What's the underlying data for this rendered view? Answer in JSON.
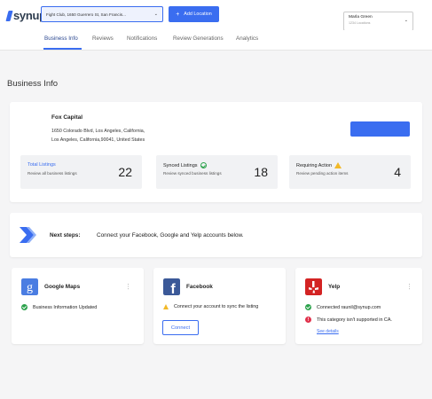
{
  "brand": {
    "logo_text": "synup",
    "accent": "#3a6df0"
  },
  "header": {
    "location_select": {
      "value": "Fight Club, 1650 Guerrero St, San Francis..."
    },
    "add_location_label": "Add Location",
    "user": {
      "name": "Marla Green",
      "subtitle": "1234 Locations"
    }
  },
  "tabs": [
    {
      "label": "Business Info",
      "active": true
    },
    {
      "label": "Reviews",
      "active": false
    },
    {
      "label": "Notifications",
      "active": false
    },
    {
      "label": "Review Generations",
      "active": false
    },
    {
      "label": "Analytics",
      "active": false
    }
  ],
  "page": {
    "title": "Business Info"
  },
  "business": {
    "name": "Fox Capital",
    "address_line1": "1650 Colorado Blvd, Los Angeles, California,",
    "address_line2": "Los Angeles, California,90041, United States"
  },
  "stats": [
    {
      "title": "Total Listings",
      "desc": "Review all business listings",
      "value": "22",
      "icon": ""
    },
    {
      "title": "Synced Listings",
      "desc": "Review synced business listings",
      "value": "18",
      "icon": "check-circle-icon"
    },
    {
      "title": "Requiring Action",
      "desc": "Review pending action items",
      "value": "4",
      "icon": "warning-icon"
    }
  ],
  "next_steps": {
    "label": "Next steps:",
    "text": "Connect your Facebook, Google and Yelp accounts below."
  },
  "sources": {
    "google": {
      "name": "Google Maps",
      "status": "Business Information Updated",
      "color": "#4a7de2"
    },
    "facebook": {
      "name": "Facebook",
      "status": "Connect your account to sync the listing",
      "button": "Connect",
      "color": "#3b5998"
    },
    "yelp": {
      "name": "Yelp",
      "status_ok": "Connected raunil@synup.com",
      "status_err": "This category isn't supported in CA.",
      "link": "See details",
      "color": "#d32323"
    }
  }
}
